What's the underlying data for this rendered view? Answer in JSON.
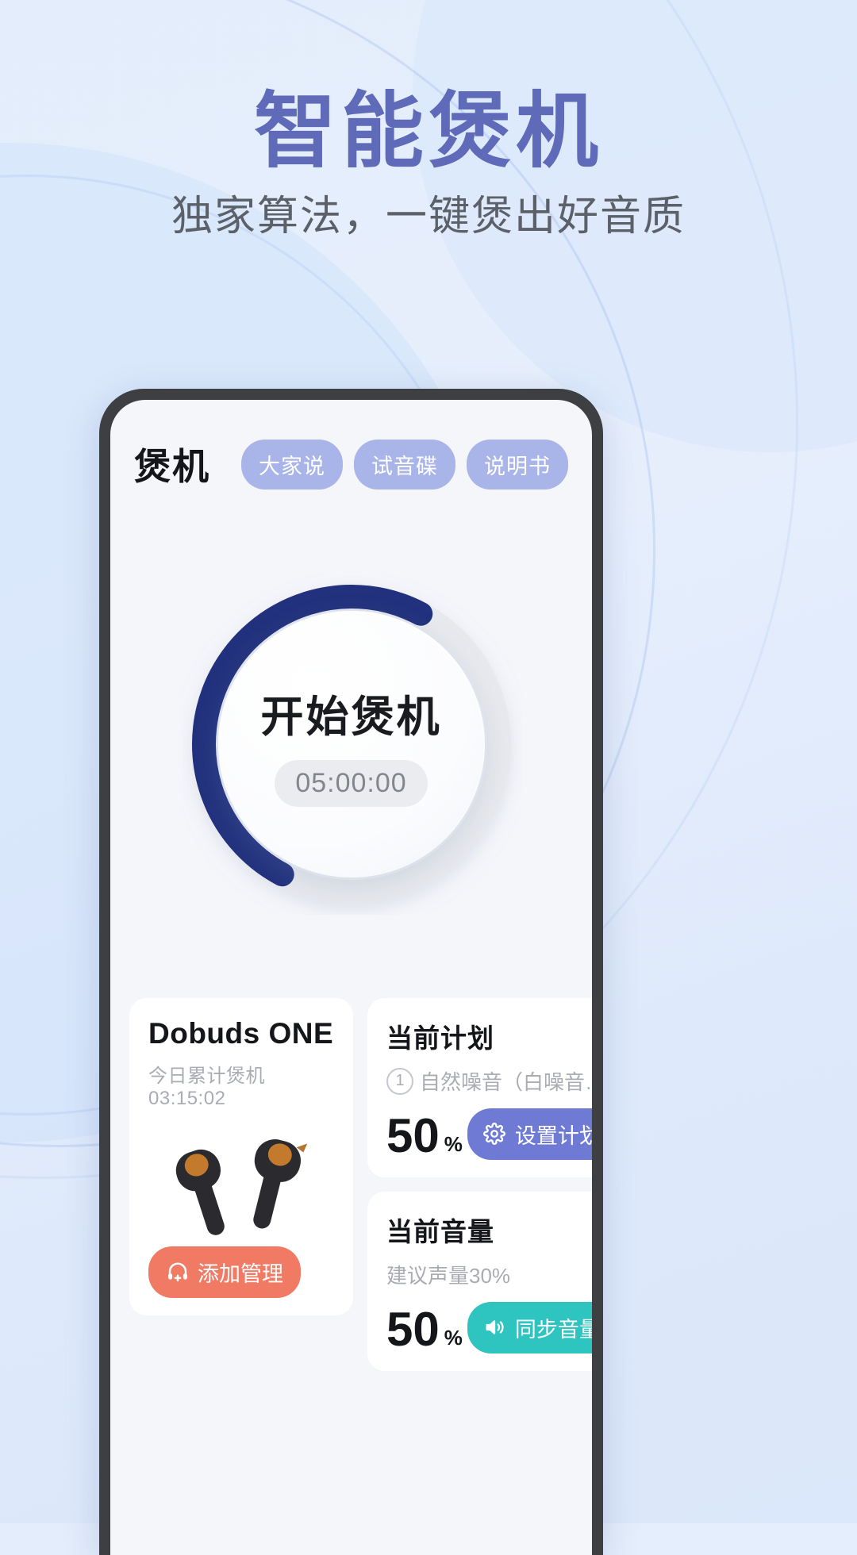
{
  "hero": {
    "title": "智能煲机",
    "subtitle": "独家算法，一键煲出好音质",
    "title_color": "#5f6ab8",
    "subtitle_color": "#5c6068"
  },
  "app": {
    "header": {
      "title": "煲机",
      "pills": [
        {
          "label": "大家说"
        },
        {
          "label": "试音碟"
        },
        {
          "label": "说明书"
        }
      ],
      "pill_color": "#a9b4e8"
    },
    "dial": {
      "label": "开始煲机",
      "timer": "05:00:00",
      "progress_percent": 50,
      "arc_color": "#22317d",
      "track_color": "#e8e9ed"
    },
    "cards": {
      "device": {
        "name": "Dobuds ONE",
        "today_label": "今日累计煲机",
        "today_value": "03:15:02",
        "manage_button": "添加管理",
        "manage_icon": "headset-plus-icon",
        "manage_color": "#f07a63"
      },
      "plan": {
        "title": "当前计划",
        "index": "1",
        "desc": "自然噪音（白噪音…",
        "value": "50",
        "unit": "%",
        "button": "设置计划",
        "button_icon": "gear-icon",
        "button_color": "#6f7ad4"
      },
      "volume": {
        "title": "当前音量",
        "desc": "建议声量30%",
        "value": "50",
        "unit": "%",
        "button": "同步音量",
        "button_icon": "speaker-icon",
        "button_color": "#2ec4c0"
      }
    }
  }
}
